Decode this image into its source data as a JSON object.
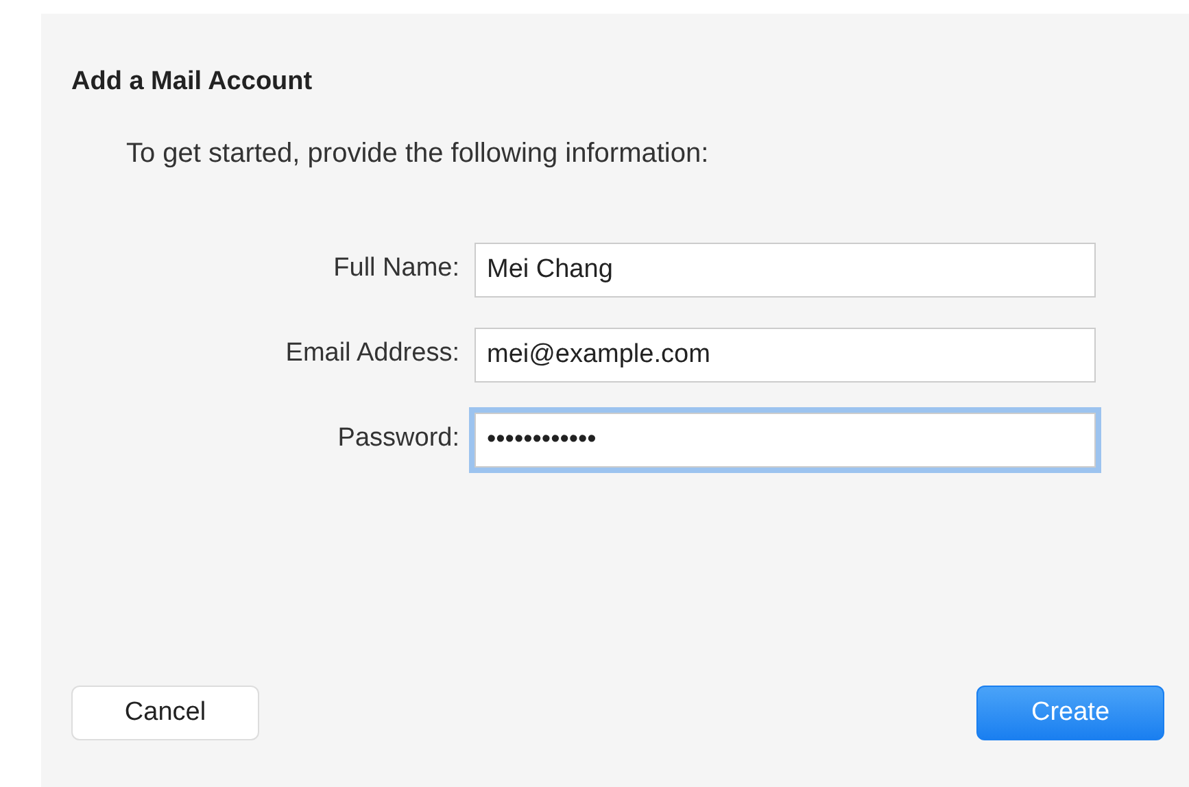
{
  "title": "Add a Mail Account",
  "instructions": "To get started, provide the following information:",
  "fields": [
    {
      "label": "Full Name:",
      "value": "Mei Chang",
      "focused": false
    },
    {
      "label": "Email Address:",
      "value": "mei@example.com",
      "focused": false
    },
    {
      "label": "Password:",
      "value": "••••••••••••",
      "focused": true
    }
  ],
  "buttons": [
    {
      "label": "Cancel",
      "kind": "secondary"
    },
    {
      "label": "Create",
      "kind": "primary"
    }
  ]
}
